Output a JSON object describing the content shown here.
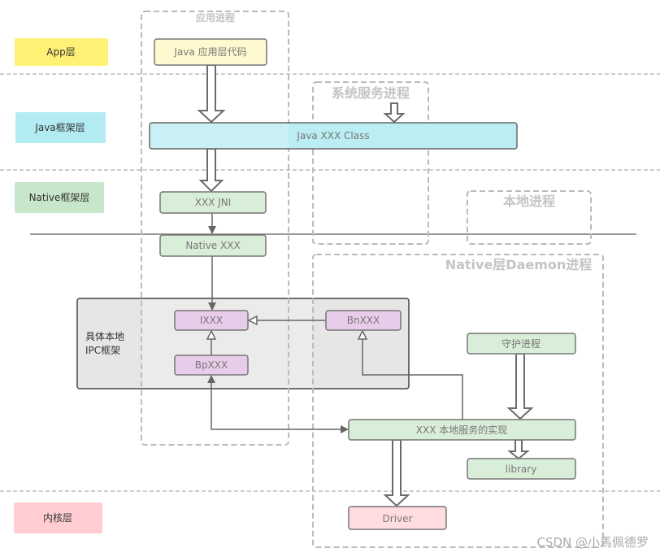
{
  "layers": {
    "app": {
      "label": "App层",
      "color": "#fff176"
    },
    "java": {
      "label": "Java框架层",
      "color": "#b2ebf2"
    },
    "native": {
      "label": "Native框架层",
      "color": "#c8e6c9"
    },
    "kernel": {
      "label": "内核层",
      "color": "#ffcdd2"
    }
  },
  "processes": {
    "app": "应用进程",
    "system": "系统服务进程",
    "local": "本地进程",
    "daemon": "Native层Daemon进程"
  },
  "nodes": {
    "java_app_code": "Java 应用层代码",
    "java_class": "Java XXX Class",
    "jni": "XXX JNI",
    "native_xxx": "Native XXX",
    "ixxx": "IXXX",
    "bnxxx": "BnXXX",
    "bpxxx": "BpXXX",
    "ipc_line1": "具体本地",
    "ipc_line2": "IPC框架",
    "daemon": "守护进程",
    "service_impl": "XXX 本地服务的实现",
    "library": "library",
    "driver": "Driver"
  },
  "colors": {
    "yellow_node": "#fff9d0",
    "cyan_node": "#c9f0f5",
    "green_node": "#d9eed9",
    "purple_node": "#e8cdea",
    "pink_node": "#ffdce0",
    "ipc_bg": "#e6e6e6"
  },
  "watermark": "CSDN @小馬佩德罗"
}
